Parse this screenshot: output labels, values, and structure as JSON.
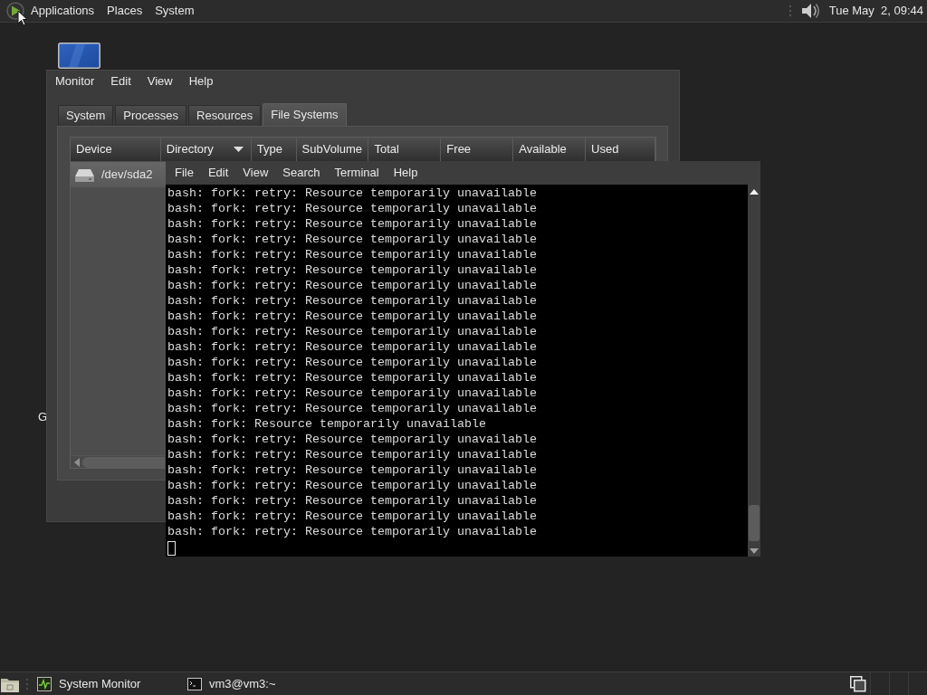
{
  "top_panel": {
    "menus": [
      "Applications",
      "Places",
      "System"
    ],
    "clock": "Tue May  2, 09:44"
  },
  "desktop": {
    "icon_label": "G"
  },
  "system_monitor": {
    "menu": [
      "Monitor",
      "Edit",
      "View",
      "Help"
    ],
    "tabs": [
      {
        "label": "System",
        "selected": false
      },
      {
        "label": "Processes",
        "selected": false
      },
      {
        "label": "Resources",
        "selected": false
      },
      {
        "label": "File Systems",
        "selected": true
      }
    ],
    "columns": [
      {
        "label": "Device",
        "sorted": false
      },
      {
        "label": "Directory",
        "sorted": true
      },
      {
        "label": "Type",
        "sorted": false
      },
      {
        "label": "SubVolume",
        "sorted": false
      },
      {
        "label": "Total",
        "sorted": false
      },
      {
        "label": "Free",
        "sorted": false
      },
      {
        "label": "Available",
        "sorted": false
      },
      {
        "label": "Used",
        "sorted": false
      }
    ],
    "rows": [
      {
        "device": "/dev/sda2",
        "selected": true
      }
    ]
  },
  "terminal": {
    "menu": [
      "File",
      "Edit",
      "View",
      "Search",
      "Terminal",
      "Help"
    ],
    "lines": [
      "bash: fork: retry: Resource temporarily unavailable",
      "bash: fork: retry: Resource temporarily unavailable",
      "bash: fork: retry: Resource temporarily unavailable",
      "bash: fork: retry: Resource temporarily unavailable",
      "bash: fork: retry: Resource temporarily unavailable",
      "bash: fork: retry: Resource temporarily unavailable",
      "bash: fork: retry: Resource temporarily unavailable",
      "bash: fork: retry: Resource temporarily unavailable",
      "bash: fork: retry: Resource temporarily unavailable",
      "bash: fork: retry: Resource temporarily unavailable",
      "bash: fork: retry: Resource temporarily unavailable",
      "bash: fork: retry: Resource temporarily unavailable",
      "bash: fork: retry: Resource temporarily unavailable",
      "bash: fork: retry: Resource temporarily unavailable",
      "bash: fork: retry: Resource temporarily unavailable",
      "bash: fork: Resource temporarily unavailable",
      "bash: fork: retry: Resource temporarily unavailable",
      "bash: fork: retry: Resource temporarily unavailable",
      "bash: fork: retry: Resource temporarily unavailable",
      "bash: fork: retry: Resource temporarily unavailable",
      "bash: fork: retry: Resource temporarily unavailable",
      "bash: fork: retry: Resource temporarily unavailable",
      "bash: fork: retry: Resource temporarily unavailable"
    ]
  },
  "taskbar": {
    "tasks": [
      {
        "kind": "monitor",
        "label": "System Monitor"
      },
      {
        "kind": "terminal",
        "label": "vm3@vm3:~"
      }
    ]
  }
}
